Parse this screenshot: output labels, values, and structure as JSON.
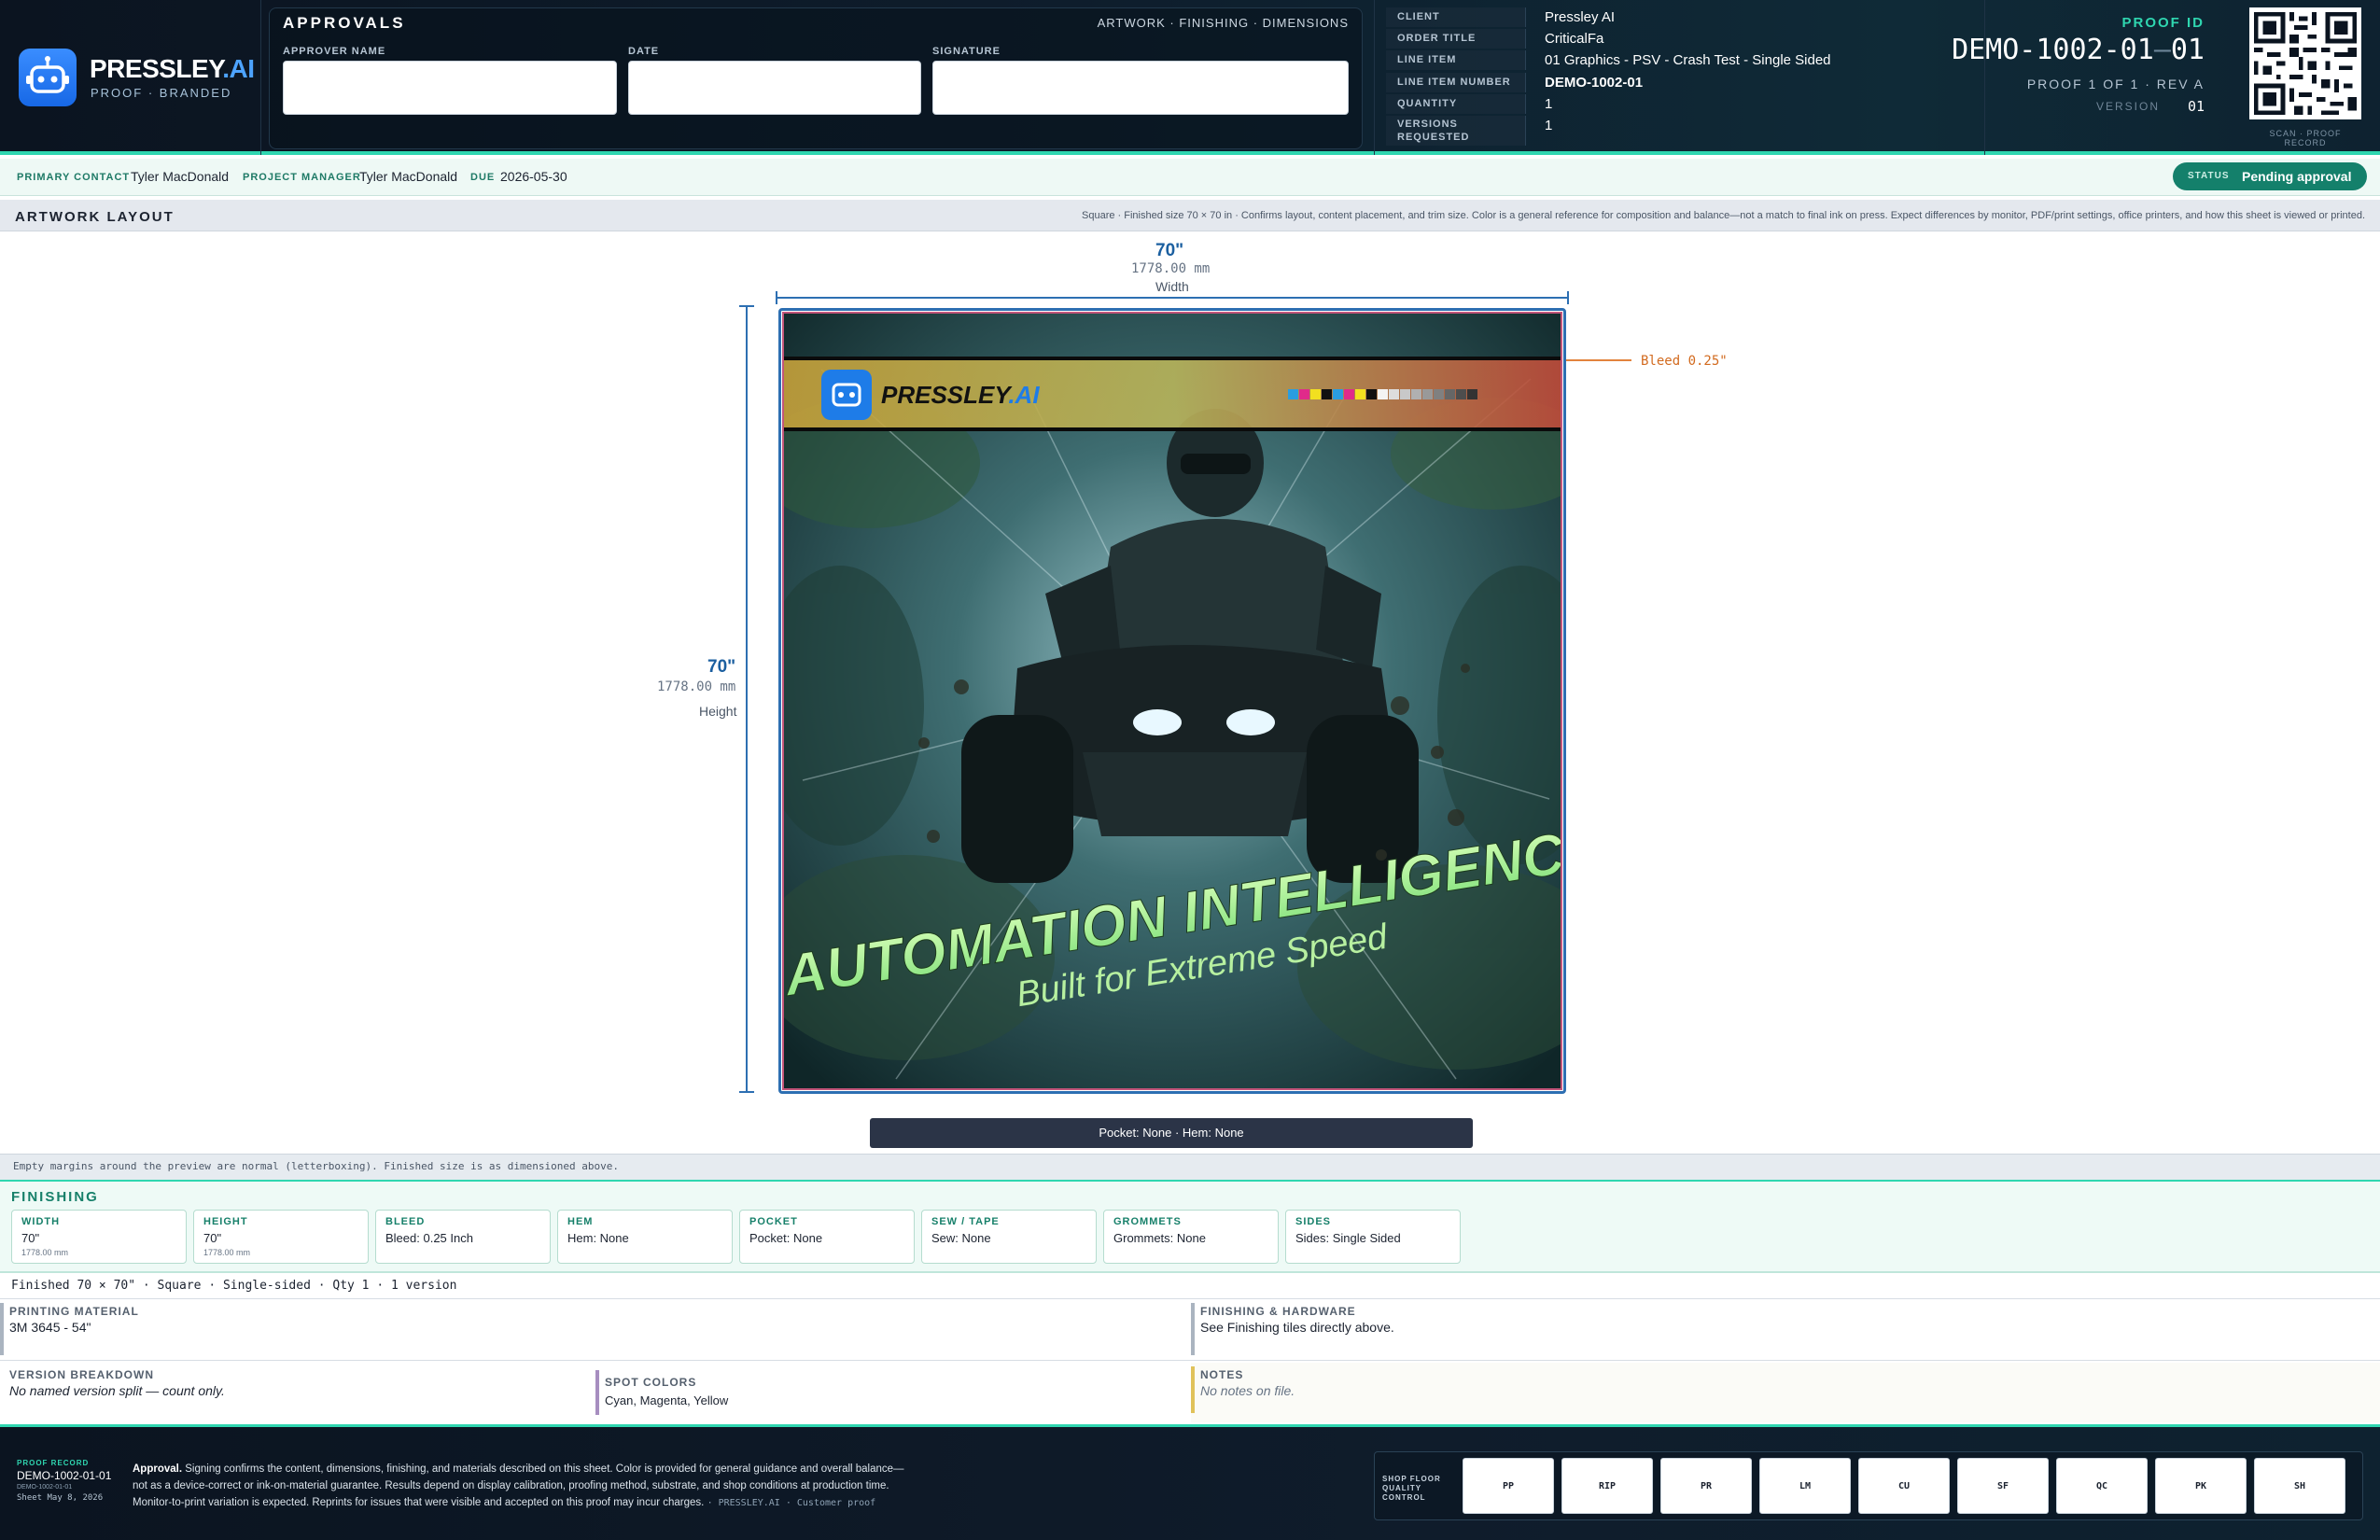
{
  "brand": {
    "name": "PRESSLEY",
    "name_suffix": ".AI",
    "subtitle": "PROOF · BRANDED",
    "logo_icon": "robot-icon"
  },
  "approvals": {
    "title": "APPROVALS",
    "sections": "ARTWORK · FINISHING · DIMENSIONS",
    "fields": {
      "approver_label": "APPROVER NAME",
      "date_label": "DATE",
      "signature_label": "SIGNATURE",
      "approver_value": "",
      "date_value": "",
      "signature_value": ""
    }
  },
  "order": {
    "rows": [
      {
        "key": "CLIENT",
        "value": "Pressley AI"
      },
      {
        "key": "ORDER TITLE",
        "value": "CriticalFa"
      },
      {
        "key": "LINE ITEM",
        "value": "01 Graphics - PSV - Crash Test - Single Sided"
      },
      {
        "key": "LINE ITEM NUMBER",
        "value": "DEMO-1002-01"
      },
      {
        "key": "QUANTITY",
        "value": "1"
      },
      {
        "key": "VERSIONS",
        "key2": "REQUESTED",
        "value": "1"
      }
    ]
  },
  "proof": {
    "label": "PROOF ID",
    "id_main": "DEMO-1002-01",
    "id_sep": "—",
    "id_suffix": "01",
    "proof_of": "PROOF 1 OF 1 · REV A",
    "version_label": "VERSION",
    "version_value": "01",
    "qr_caption": "SCAN · PROOF RECORD"
  },
  "contacts": {
    "primary_label": "PRIMARY CONTACT",
    "primary_value": "Tyler MacDonald",
    "pm_label": "PROJECT MANAGER",
    "pm_value": "Tyler MacDonald",
    "due_label": "DUE",
    "due_value": "2026-05-30",
    "status_label": "STATUS",
    "status_value": "Pending approval",
    "status_color": "#14806b"
  },
  "artwork": {
    "title": "ARTWORK LAYOUT",
    "note": "Square · Finished size 70 × 70 in · Confirms layout, content placement, and trim size. Color is a general reference for composition and balance—not a match to final ink on press. Expect differences by monitor, PDF/print settings, office printers, and how this sheet is viewed or printed.",
    "width_in": "70\"",
    "width_mm": "1778.00 mm",
    "width_word": "Width",
    "height_in": "70\"",
    "height_mm": "1778.00 mm",
    "height_word": "Height",
    "bleed_label": "Bleed 0.25\"",
    "pocket_hem": "Pocket: None · Hem: None",
    "letterbox_note": "Empty margins around the preview are normal (letterboxing). Finished size is as dimensioned above.",
    "image": {
      "header_brand": "PRESSLEY",
      "header_brand_suffix": ".AI",
      "headline": "AUTOMATION INTELLIGENCE",
      "subhead": "Built for Extreme Speed",
      "swatches": [
        "#2a9de0",
        "#e02a8a",
        "#f2e020",
        "#111111",
        "#2a9de0",
        "#e02a8a",
        "#f2e020",
        "#111111",
        "#f4f4f4",
        "#dddddd",
        "#c8c8c8",
        "#b0b0b0",
        "#999999",
        "#808080",
        "#666666",
        "#4d4d4d",
        "#333333"
      ]
    }
  },
  "finishing": {
    "title": "FINISHING",
    "tiles": [
      {
        "key": "WIDTH",
        "value": "70\"",
        "sub": "1778.00 mm"
      },
      {
        "key": "HEIGHT",
        "value": "70\"",
        "sub": "1778.00 mm"
      },
      {
        "key": "BLEED",
        "value": "Bleed: 0.25 Inch"
      },
      {
        "key": "HEM",
        "value": "Hem: None"
      },
      {
        "key": "POCKET",
        "value": "Pocket: None"
      },
      {
        "key": "SEW / TAPE",
        "value": "Sew: None"
      },
      {
        "key": "GROMMETS",
        "value": "Grommets: None"
      },
      {
        "key": "SIDES",
        "value": "Sides: Single Sided"
      }
    ],
    "summary": "Finished 70 × 70\" · Square · Single-sided · Qty 1 · 1 version"
  },
  "details": {
    "material_label": "PRINTING MATERIAL",
    "material_value": "3M 3645 - 54\"",
    "hardware_label": "FINISHING & HARDWARE",
    "hardware_value": "See Finishing tiles directly above.",
    "versions_label": "VERSION BREAKDOWN",
    "versions_value": "No named version split — count only.",
    "spot_label": "SPOT COLORS",
    "spot_value": "Cyan, Magenta, Yellow",
    "notes_label": "NOTES",
    "notes_value": "No notes on file."
  },
  "footer": {
    "record_label": "PROOF RECORD",
    "record_id": "DEMO-1002-01-01",
    "record_id_small": "DEMO-1002-01-01",
    "record_date": "Sheet May 8, 2026",
    "approval_title": "Approval.",
    "approval_line1": "Signing confirms the content, dimensions, finishing, and materials described on this sheet. Color is provided for general guidance and overall balance—",
    "approval_line2": "not as a device-correct or ink-on-material guarantee. Results depend on display calibration, proofing method, substrate, and shop conditions at production time.",
    "approval_line3": "Monitor-to-print variation is expected. Reprints for issues that were visible and accepted on this proof may incur charges.",
    "approval_tag": "· PRESSLEY.AI · Customer proof",
    "qc_label_1": "SHOP FLOOR",
    "qc_label_2": "QUALITY CONTROL",
    "qc_steps": [
      "PP",
      "RIP",
      "PR",
      "LM",
      "CU",
      "SF",
      "QC",
      "PK",
      "SH"
    ]
  }
}
